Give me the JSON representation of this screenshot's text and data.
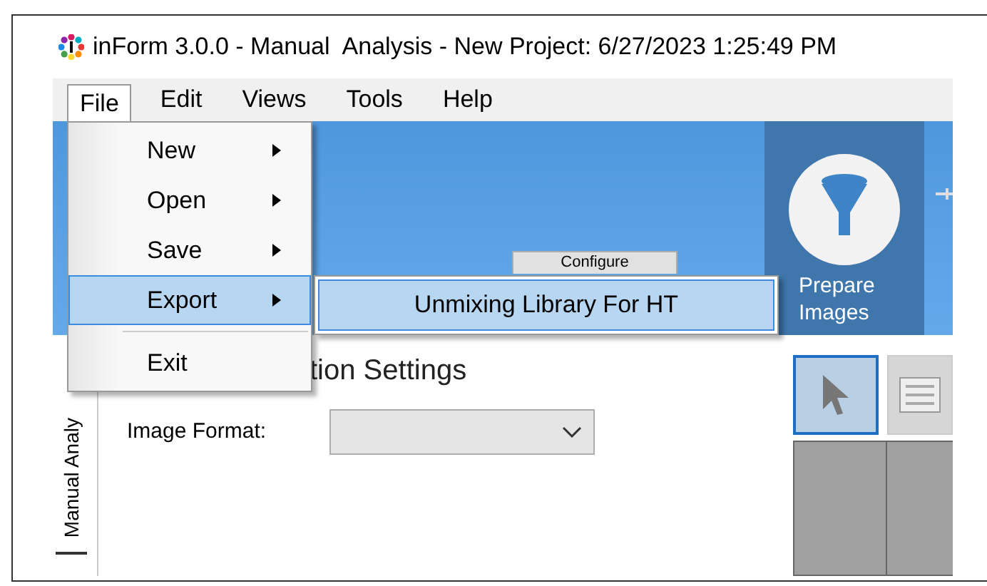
{
  "window": {
    "title": "inForm 3.0.0 - Manual  Analysis - New Project: 6/27/2023 1:25:49 PM"
  },
  "menu_bar": [
    {
      "label": "File",
      "selected": true
    },
    {
      "label": "Edit",
      "selected": false
    },
    {
      "label": "Views",
      "selected": false
    },
    {
      "label": "Tools",
      "selected": false
    },
    {
      "label": "Help",
      "selected": false
    }
  ],
  "file_menu": [
    {
      "kind": "item",
      "label": "New",
      "submenu": true,
      "selected": false
    },
    {
      "kind": "item",
      "label": "Open",
      "submenu": true,
      "selected": false
    },
    {
      "kind": "item",
      "label": "Save",
      "submenu": true,
      "selected": false
    },
    {
      "kind": "item",
      "label": "Export",
      "submenu": true,
      "selected": true
    },
    {
      "kind": "separator"
    },
    {
      "kind": "item",
      "label": "Exit",
      "submenu": false,
      "selected": false
    }
  ],
  "export_submenu": [
    {
      "label": "Unmixing Library For HT",
      "selected": true
    }
  ],
  "ribbon": {
    "configure_button": "Configure",
    "prepare_button": "Prepare Images"
  },
  "side_tab": "Manual Analy",
  "settings": {
    "heading": "tion Settings",
    "image_format_label": "Image Format:"
  },
  "toolbar": [
    {
      "kind": "pointer",
      "selected": true
    },
    {
      "kind": "text",
      "selected": false
    }
  ]
}
